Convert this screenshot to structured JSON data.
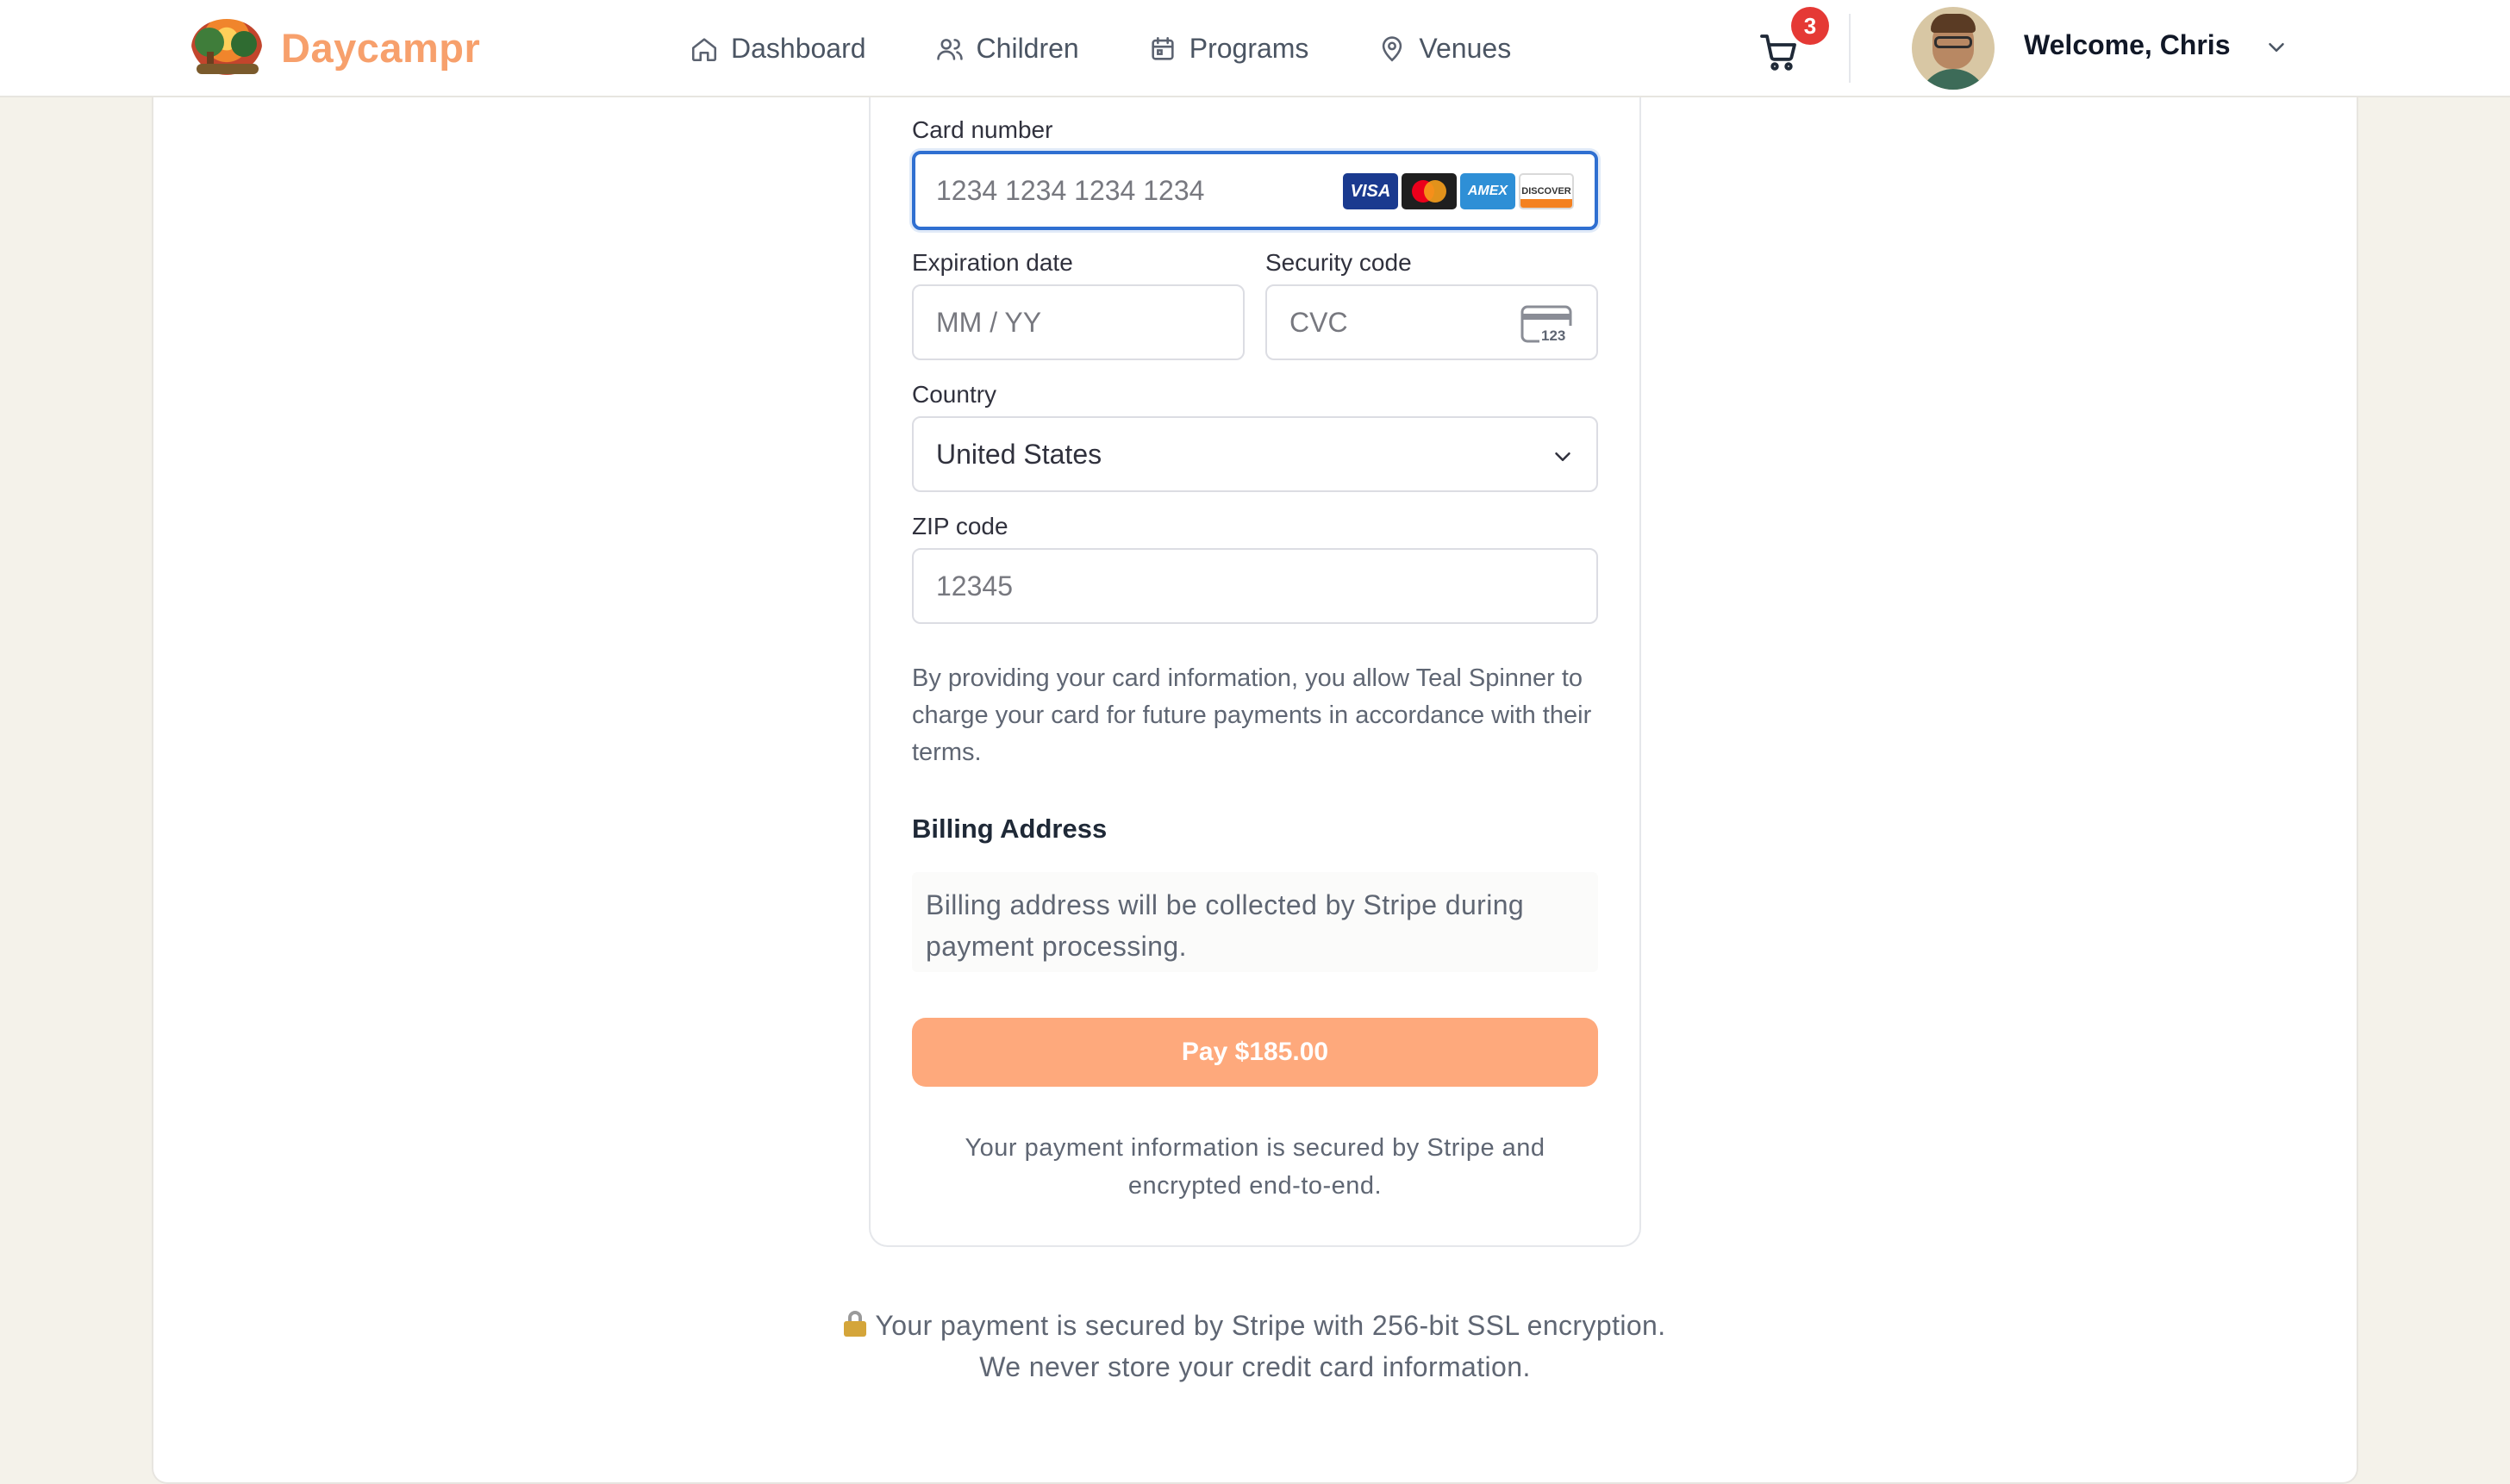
{
  "app": {
    "brand_name": "Daycampr",
    "brand_color": "#f7a06c",
    "accent_focus_color": "#2f6fd1",
    "pay_button_color": "#fea97c"
  },
  "nav": {
    "items": [
      {
        "label": "Dashboard",
        "icon": "home-icon"
      },
      {
        "label": "Children",
        "icon": "users-icon"
      },
      {
        "label": "Programs",
        "icon": "calendar-icon"
      },
      {
        "label": "Venues",
        "icon": "map-pin-icon"
      }
    ]
  },
  "header": {
    "cart_count": "3",
    "cart_icon": "shopping-cart-icon",
    "welcome_text": "Welcome, Chris",
    "user_menu_icon": "chevron-down-icon"
  },
  "payment_form": {
    "card_number": {
      "label": "Card number",
      "placeholder": "1234 1234 1234 1234",
      "brands": [
        "VISA",
        "mastercard",
        "AMEX",
        "DISCOVER"
      ]
    },
    "expiration": {
      "label": "Expiration date",
      "placeholder": "MM / YY"
    },
    "security_code": {
      "label": "Security code",
      "placeholder": "CVC",
      "icon_text": "123"
    },
    "country": {
      "label": "Country",
      "value": "United States"
    },
    "zip": {
      "label": "ZIP code",
      "placeholder": "12345"
    },
    "authorization_notice": "By providing your card information, you allow Teal Spinner to charge your card for future payments in accordance with their terms.",
    "billing_title": "Billing Address",
    "billing_note": "Billing address will be collected by Stripe during payment processing.",
    "pay_button": "Pay $185.00",
    "secure_note": "Your payment information is secured by Stripe and encrypted end-to-end."
  },
  "footer": {
    "line1": "Your payment is secured by Stripe with 256-bit SSL encryption.",
    "line2": "We never store your credit card information."
  }
}
